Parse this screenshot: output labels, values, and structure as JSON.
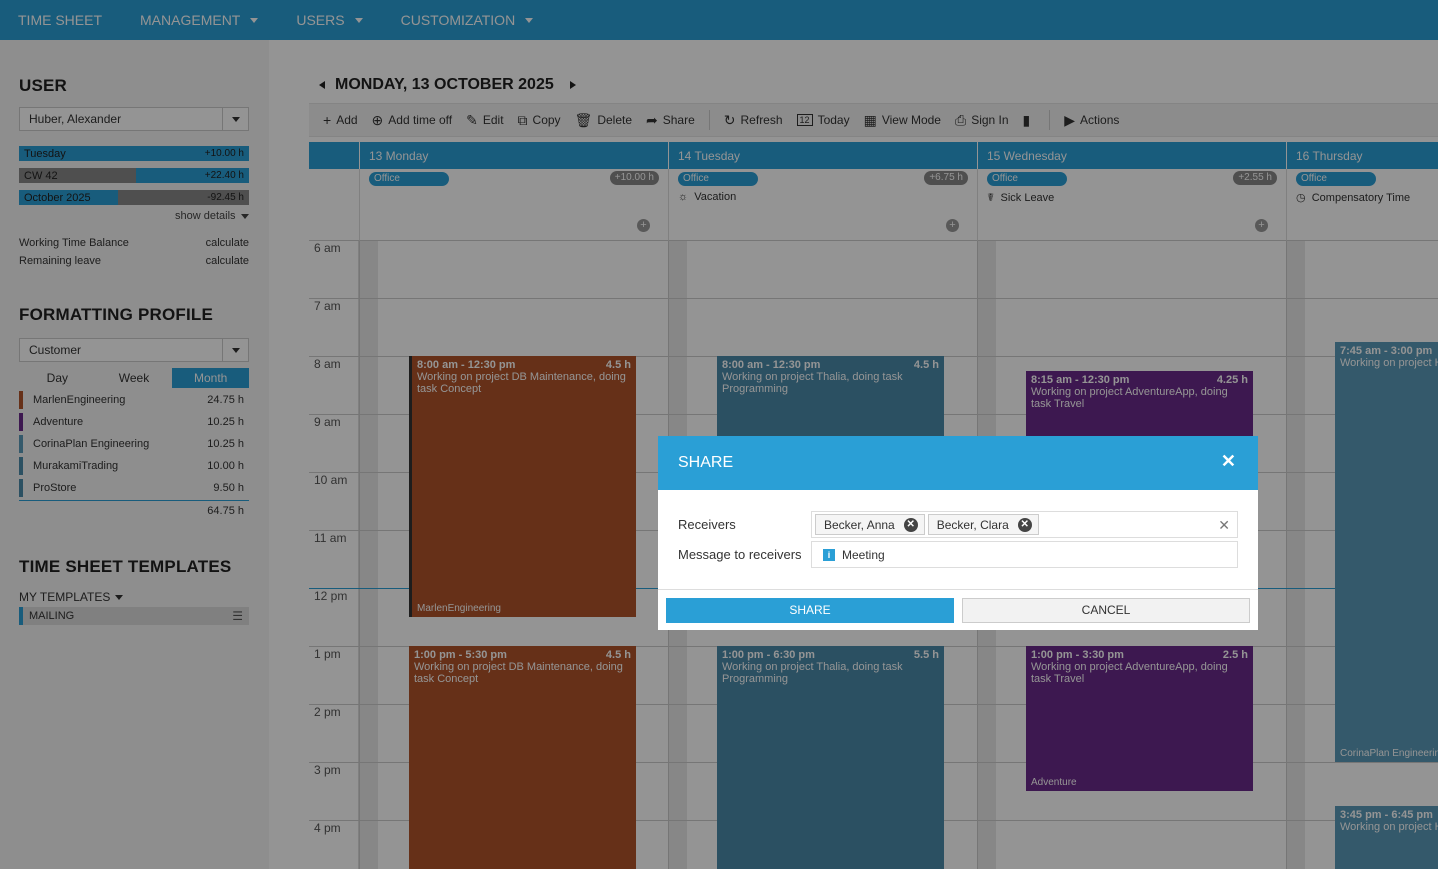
{
  "topnav": {
    "items": [
      {
        "label": "TIME SHEET",
        "has_dropdown": false
      },
      {
        "label": "MANAGEMENT",
        "has_dropdown": true
      },
      {
        "label": "USERS",
        "has_dropdown": true
      },
      {
        "label": "CUSTOMIZATION",
        "has_dropdown": true
      }
    ]
  },
  "sidebar": {
    "user_heading": "USER",
    "user_select": "Huber, Alexander",
    "balances": [
      {
        "label": "Tuesday",
        "value": "+10.00 h",
        "fill": 1.0
      },
      {
        "label": "CW 42",
        "value": "+22.40 h",
        "fill": 1.0
      },
      {
        "label": "October 2025",
        "value": "-92.45 h",
        "fill": 0.43
      }
    ],
    "show_details": "show details",
    "working_time_balance_label": "Working Time Balance",
    "working_time_balance_value": "calculate",
    "remaining_leave_label": "Remaining leave",
    "remaining_leave_value": "calculate",
    "formatting_heading": "FORMATTING PROFILE",
    "formatting_select": "Customer",
    "period_tabs": [
      "Day",
      "Week",
      "Month"
    ],
    "period_active": "Month",
    "projects": [
      {
        "name": "MarlenEngineering",
        "hours": "24.75 h",
        "color": "#b0542a"
      },
      {
        "name": "Adventure",
        "hours": "10.25 h",
        "color": "#6a2a8a"
      },
      {
        "name": "CorinaPlan Engineering",
        "hours": "10.25 h",
        "color": "#5a9ab8"
      },
      {
        "name": "MurakamiTrading",
        "hours": "10.00 h",
        "color": "#4a8aaa"
      },
      {
        "name": "ProStore",
        "hours": "9.50 h",
        "color": "#4a8aaa"
      }
    ],
    "projects_total": "64.75 h",
    "templates_heading": "TIME SHEET TEMPLATES",
    "my_templates": "MY TEMPLATES",
    "template_item": "MAILING"
  },
  "calendar": {
    "date_title": "MONDAY, 13 OCTOBER 2025",
    "toolbar": {
      "add": "Add",
      "add_time_off": "Add time off",
      "edit": "Edit",
      "copy": "Copy",
      "delete": "Delete",
      "share": "Share",
      "refresh": "Refresh",
      "today": "Today",
      "view_mode": "View Mode",
      "sign_in": "Sign In",
      "actions": "Actions",
      "today_icon_num": "12"
    },
    "days": [
      {
        "header": "13 Monday",
        "pill": "Office",
        "balance": "+10.00 h",
        "absence": ""
      },
      {
        "header": "14 Tuesday",
        "pill": "Office",
        "balance": "+6.75 h",
        "absence": "Vacation"
      },
      {
        "header": "15 Wednesday",
        "pill": "Office",
        "balance": "+2.55 h",
        "absence": "Sick Leave"
      },
      {
        "header": "16 Thursday",
        "pill": "Office",
        "balance": "",
        "absence": "Compensatory Time"
      }
    ],
    "hours": [
      "6 am",
      "7 am",
      "8 am",
      "9 am",
      "10 am",
      "11 am",
      "12 pm",
      "1 pm",
      "2 pm",
      "3 pm",
      "4 pm"
    ],
    "events": {
      "mon_am": {
        "time": "8:00 am - 12:30 pm",
        "dur": "4.5 h",
        "desc": "Working on project DB Maintenance, doing task Concept",
        "customer": "MarlenEngineering"
      },
      "mon_pm": {
        "time": "1:00 pm - 5:30 pm",
        "dur": "4.5 h",
        "desc": "Working on project DB Maintenance, doing task Concept"
      },
      "tue_am": {
        "time": "8:00 am - 12:30 pm",
        "dur": "4.5 h",
        "desc": "Working on project Thalia, doing task Programming"
      },
      "tue_pm": {
        "time": "1:00 pm - 6:30 pm",
        "dur": "5.5 h",
        "desc": "Working on project Thalia, doing task Programming"
      },
      "wed_am": {
        "time": "8:15 am - 12:30 pm",
        "dur": "4.25 h",
        "desc": "Working on project AdventureApp, doing task Travel"
      },
      "wed_pm": {
        "time": "1:00 pm - 3:30 pm",
        "dur": "2.5 h",
        "desc": "Working on project AdventureApp, doing task Travel",
        "customer": "Adventure"
      },
      "thu_am": {
        "time": "7:45 am - 3:00 pm",
        "desc": "Working on project H",
        "customer": "CorinaPlan Engineering"
      },
      "thu_pm": {
        "time": "3:45 pm - 6:45 pm",
        "desc": "Working on project H"
      }
    }
  },
  "dialog": {
    "title": "SHARE",
    "receivers_label": "Receivers",
    "receivers": [
      "Becker, Anna",
      "Becker, Clara"
    ],
    "message_label": "Message to receivers",
    "message_value": "Meeting",
    "share_button": "SHARE",
    "cancel_button": "CANCEL"
  },
  "colors": {
    "accent": "#2a9fd6",
    "overlay": "rgba(0,0,0,0.42)"
  }
}
